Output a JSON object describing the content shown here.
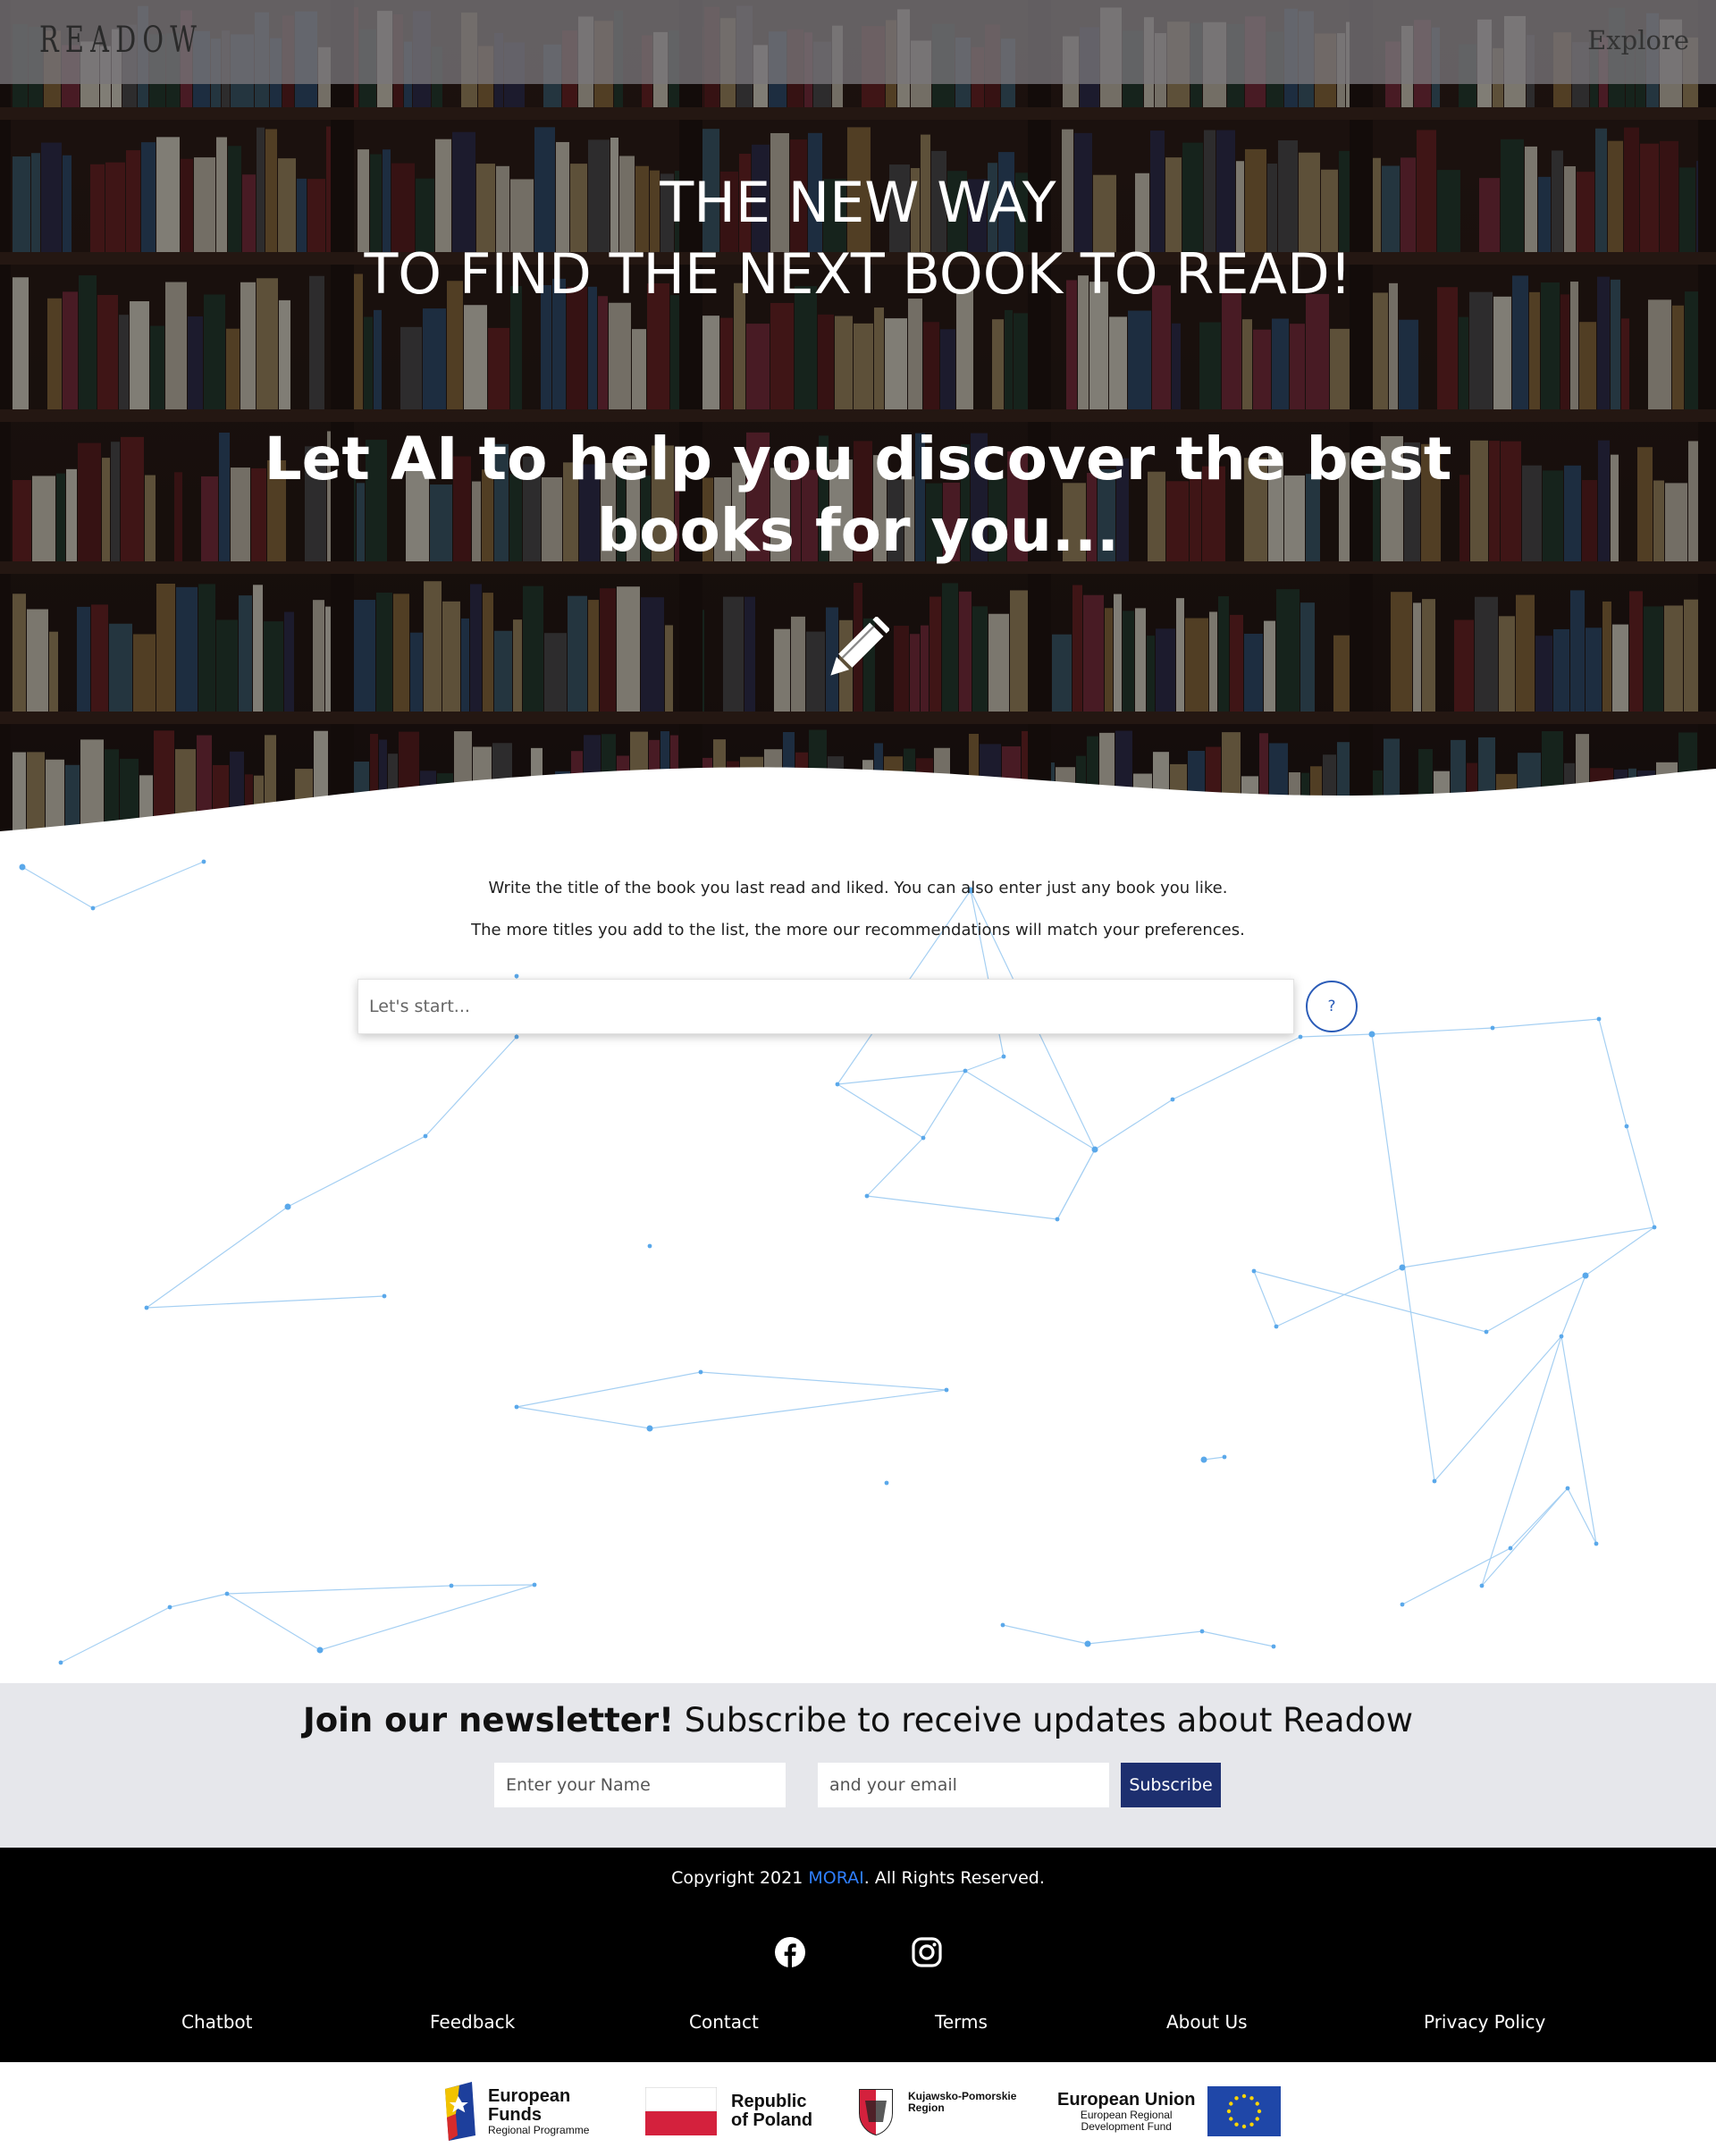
{
  "header": {
    "logo": "READOW",
    "nav_explore": "Explore"
  },
  "hero": {
    "line1": "THE NEW WAY",
    "line2": "TO FIND THE NEXT BOOK TO READ!",
    "tagline1": "Let AI to help you discover the best",
    "tagline2": "books for you..."
  },
  "search": {
    "instruction1": "Write the title of the book you last read and liked. You can also enter just any book you like.",
    "instruction2": "The more titles you add to the list, the more our recommendations will match your preferences.",
    "placeholder": "Let's start...",
    "help_label": "?"
  },
  "newsletter": {
    "title_bold": "Join our newsletter!",
    "title_rest": " Subscribe to receive updates about Readow",
    "name_placeholder": "Enter your Name",
    "email_placeholder": "and your email",
    "subscribe_label": "Subscribe",
    "button_color": "#1d2f6f"
  },
  "footer": {
    "copyright_prefix": "Copyright 2021 ",
    "copyright_brand": "MORAI",
    "copyright_suffix": ". All Rights Reserved.",
    "social": [
      "facebook-icon",
      "instagram-icon"
    ],
    "links": [
      "Chatbot",
      "Feedback",
      "Contact",
      "Terms",
      "About Us",
      "Privacy Policy"
    ]
  },
  "funding": {
    "eu_funds_title": "European",
    "eu_funds_title2": "Funds",
    "eu_funds_sub": "Regional Programme",
    "poland_line1": "Republic",
    "poland_line2": "of Poland",
    "region_line1": "Kujawsko-Pomorskie",
    "region_line2": "Region",
    "eu_title": "European Union",
    "eu_sub1": "European Regional",
    "eu_sub2": "Development Fund"
  },
  "colors": {
    "accent_link": "#2f7fff",
    "help_border": "#2b5cb8",
    "network_lines": "#8fc4f0"
  }
}
